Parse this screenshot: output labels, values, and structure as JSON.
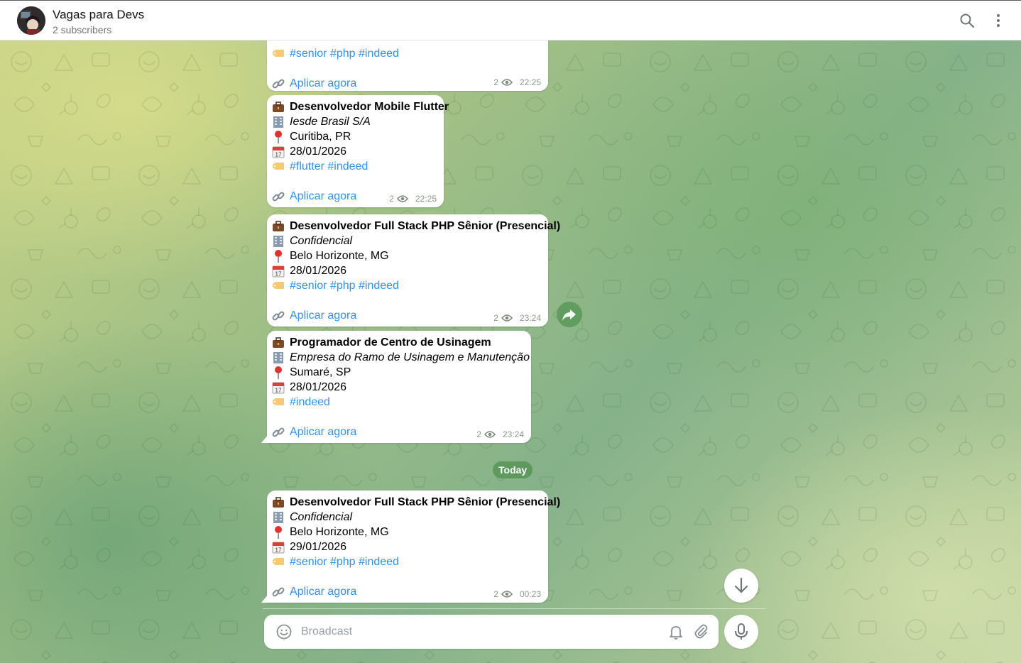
{
  "header": {
    "title": "Vagas para Devs",
    "subtitle": "2 subscribers",
    "search_icon": "search-icon",
    "menu_icon": "more-vertical-icon"
  },
  "colors": {
    "link": "#3390ec",
    "accent_green": "#5e9a5d",
    "bubble": "#ffffff"
  },
  "messages": [
    {
      "partial": true,
      "tags": [
        "#senior",
        "#php",
        "#indeed"
      ],
      "link": "Aplicar agora",
      "views": "2",
      "time": "22:25"
    },
    {
      "title": "Desenvolvedor Mobile Flutter",
      "company": "Iesde Brasil S/A",
      "location": "Curitiba, PR",
      "date": "28/01/2026",
      "tags": [
        "#flutter",
        "#indeed"
      ],
      "link": "Aplicar agora",
      "views": "2",
      "time": "22:25"
    },
    {
      "title": "Desenvolvedor Full Stack PHP Sênior (Presencial)",
      "company": "Confidencial",
      "location": "Belo Horizonte, MG",
      "date": "28/01/2026",
      "tags": [
        "#senior",
        "#php",
        "#indeed"
      ],
      "link": "Aplicar agora",
      "views": "2",
      "time": "23:24"
    },
    {
      "title": "Programador de Centro de Usinagem",
      "company": "Empresa do Ramo de Usinagem e Manutenção",
      "location": "Sumaré, SP",
      "date": "28/01/2026",
      "tags": [
        "#indeed"
      ],
      "link": "Aplicar agora",
      "views": "2",
      "time": "23:24"
    },
    {
      "title": "Desenvolvedor Full Stack PHP Sênior (Presencial)",
      "company": "Confidencial",
      "location": "Belo Horizonte, MG",
      "date": "29/01/2026",
      "tags": [
        "#senior",
        "#php",
        "#indeed"
      ],
      "link": "Aplicar agora",
      "views": "2",
      "time": "00:23"
    }
  ],
  "date_separator": "Today",
  "composer": {
    "placeholder": "Broadcast"
  }
}
